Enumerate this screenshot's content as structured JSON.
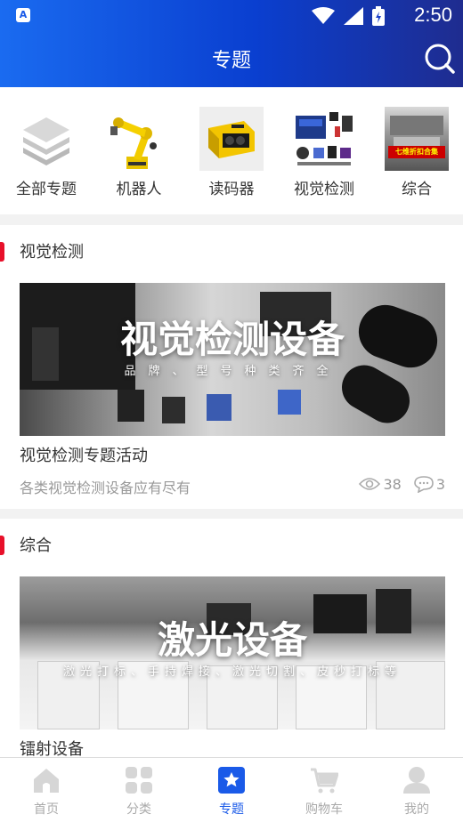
{
  "status": {
    "app_badge": "A",
    "time": "2:50"
  },
  "header": {
    "title": "专题"
  },
  "categories": [
    {
      "label": "全部专题"
    },
    {
      "label": "机器人"
    },
    {
      "label": "读码器"
    },
    {
      "label": "视觉检测"
    },
    {
      "label": "综合",
      "thumb_text": "七维折扣合集"
    }
  ],
  "sections": [
    {
      "name": "视觉检测",
      "banner_title": "视觉检测设备",
      "banner_subtitle": "品牌、型号种类齐全",
      "item_title": "视觉检测专题活动",
      "item_desc": "各类视觉检测设备应有尽有",
      "views": "38",
      "comments": "3"
    },
    {
      "name": "综合",
      "banner_title": "激光设备",
      "banner_subtitle": "激光打标、手持焊接、激光切割、皮秒打标等",
      "item_title": "镭射设备"
    }
  ],
  "tabs": [
    {
      "label": "首页"
    },
    {
      "label": "分类"
    },
    {
      "label": "专题"
    },
    {
      "label": "购物车"
    },
    {
      "label": "我的"
    }
  ],
  "colors": {
    "accent": "#1a5ae8",
    "section_marker": "#e8102a"
  }
}
